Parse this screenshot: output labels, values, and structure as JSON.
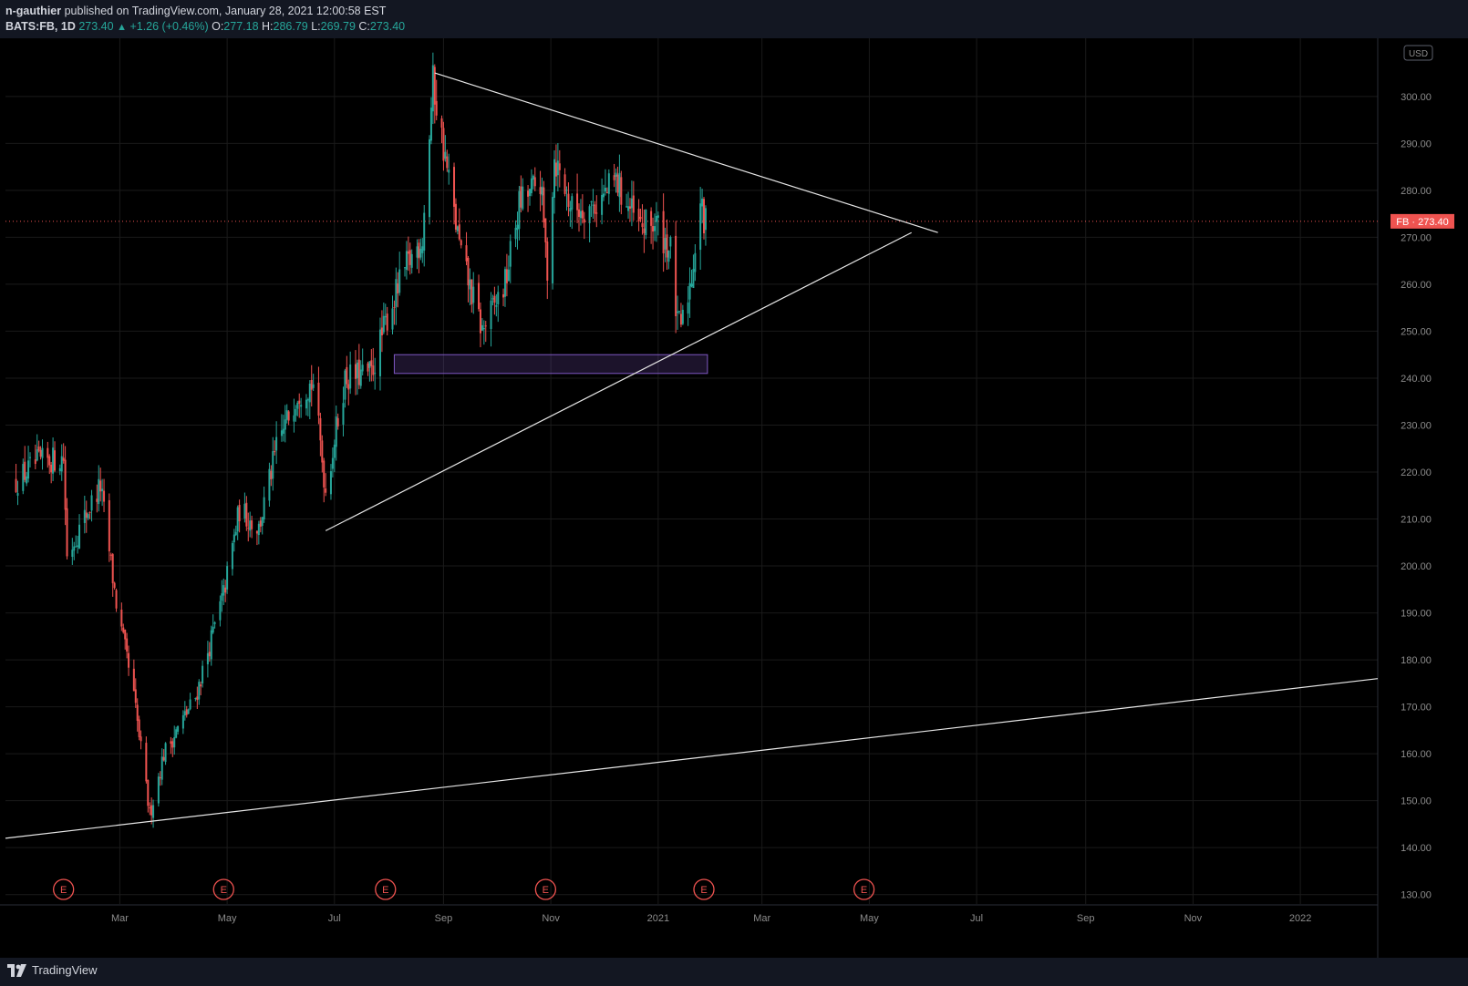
{
  "header": {
    "author": "n-gauthier",
    "published_text": "published on TradingView.com, January 28, 2021 12:00:58 EST",
    "symbol": "BATS:FB, 1D",
    "last": "273.40",
    "change": "+1.26 (+0.46%)",
    "o_label": "O:",
    "o_val": "277.18",
    "h_label": "H:",
    "h_val": "286.79",
    "l_label": "L:",
    "l_val": "269.79",
    "c_label": "C:",
    "c_val": "273.40"
  },
  "footer": {
    "brand": "TradingView"
  },
  "colors": {
    "up": "#26a69a",
    "down": "#ef5350",
    "background": "#000000",
    "grid": "#1a1a1a",
    "drawing": "#e6e6e6",
    "zone_border": "#7e57c2",
    "price_tag": "#ef5350"
  },
  "chart_data": {
    "type": "candlestick",
    "x_tick_labels": [
      "Mar",
      "May",
      "Jul",
      "Sep",
      "Nov",
      "2021",
      "Mar",
      "May",
      "Jul",
      "Sep",
      "Nov",
      "2022"
    ],
    "y_tick_labels": [
      "300.00",
      "290.00",
      "280.00",
      "270.00",
      "260.00",
      "250.00",
      "240.00",
      "230.00",
      "220.00",
      "210.00",
      "200.00",
      "190.00",
      "180.00",
      "170.00",
      "160.00",
      "150.00",
      "140.00",
      "130.00"
    ],
    "ylim": [
      128,
      312
    ],
    "currency": "USD",
    "last_price_label": "FB",
    "last_price": "273.40",
    "earnings_marker": "E",
    "earnings_dates": [
      "2020-01-29",
      "2020-04-29",
      "2020-07-30",
      "2020-10-29",
      "2021-01-27",
      "2021-04-28"
    ],
    "anchors": [
      {
        "date": "2020-01-02",
        "close": 218
      },
      {
        "date": "2020-01-14",
        "close": 222
      },
      {
        "date": "2020-01-29",
        "close": 223
      },
      {
        "date": "2020-01-31",
        "close": 202
      },
      {
        "date": "2020-02-12",
        "close": 212
      },
      {
        "date": "2020-02-19",
        "close": 217
      },
      {
        "date": "2020-02-28",
        "close": 192
      },
      {
        "date": "2020-03-09",
        "close": 172
      },
      {
        "date": "2020-03-18",
        "close": 147
      },
      {
        "date": "2020-03-26",
        "close": 160
      },
      {
        "date": "2020-04-13",
        "close": 172
      },
      {
        "date": "2020-04-29",
        "close": 194
      },
      {
        "date": "2020-05-08",
        "close": 212
      },
      {
        "date": "2020-05-19",
        "close": 208
      },
      {
        "date": "2020-05-29",
        "close": 225
      },
      {
        "date": "2020-06-10",
        "close": 237
      },
      {
        "date": "2020-06-19",
        "close": 239
      },
      {
        "date": "2020-06-26",
        "close": 216
      },
      {
        "date": "2020-07-07",
        "close": 240
      },
      {
        "date": "2020-07-22",
        "close": 241
      },
      {
        "date": "2020-07-31",
        "close": 253
      },
      {
        "date": "2020-08-10",
        "close": 263
      },
      {
        "date": "2020-08-20",
        "close": 270
      },
      {
        "date": "2020-08-26",
        "close": 303
      },
      {
        "date": "2020-09-04",
        "close": 282
      },
      {
        "date": "2020-09-11",
        "close": 266
      },
      {
        "date": "2020-09-23",
        "close": 250
      },
      {
        "date": "2020-10-06",
        "close": 260
      },
      {
        "date": "2020-10-14",
        "close": 277
      },
      {
        "date": "2020-10-26",
        "close": 282
      },
      {
        "date": "2020-10-30",
        "close": 263
      },
      {
        "date": "2020-11-03",
        "close": 287
      },
      {
        "date": "2020-11-13",
        "close": 276
      },
      {
        "date": "2020-11-27",
        "close": 277
      },
      {
        "date": "2020-12-08",
        "close": 282
      },
      {
        "date": "2020-12-21",
        "close": 272
      },
      {
        "date": "2020-12-31",
        "close": 273
      },
      {
        "date": "2021-01-08",
        "close": 267
      },
      {
        "date": "2021-01-12",
        "close": 251
      },
      {
        "date": "2021-01-15",
        "close": 252
      },
      {
        "date": "2021-01-20",
        "close": 262
      },
      {
        "date": "2021-01-25",
        "close": 278
      },
      {
        "date": "2021-01-27",
        "close": 272
      },
      {
        "date": "2021-01-28",
        "close": 273.4
      }
    ],
    "trendlines": [
      {
        "from": {
          "date": "2020-08-27",
          "price": 305
        },
        "to": {
          "date": "2021-06-09",
          "price": 271
        }
      },
      {
        "from": {
          "date": "2020-06-26",
          "price": 207.5
        },
        "to": {
          "date": "2021-05-25",
          "price": 271
        }
      },
      {
        "from": {
          "date": "2019-12-27",
          "price": 142
        },
        "to": {
          "date": "2022-02-14",
          "price": 176
        }
      }
    ],
    "support_zone": {
      "from_date": "2020-08-04",
      "to_date": "2021-01-29",
      "top": 245,
      "bottom": 241
    }
  }
}
